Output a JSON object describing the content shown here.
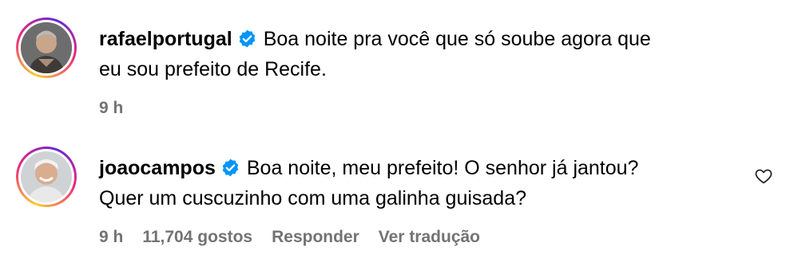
{
  "comments": [
    {
      "username": "rafaelportugal",
      "text_line1": "Boa noite pra você que só soube agora que",
      "text_line2": "eu sou prefeito de Recife.",
      "time": "9 h"
    },
    {
      "username": "joaocampos",
      "text_line1": "Boa noite, meu prefeito! O senhor já jantou?",
      "text_line2": "Quer um cuscuzinho com uma galinha guisada?",
      "time": "9 h",
      "likes": "11,704 gostos",
      "reply": "Responder",
      "translate": "Ver tradução"
    }
  ],
  "colors": {
    "verified": "#0095f6",
    "meta": "#737373"
  },
  "icons": [
    "verified-badge-icon",
    "heart-icon"
  ]
}
